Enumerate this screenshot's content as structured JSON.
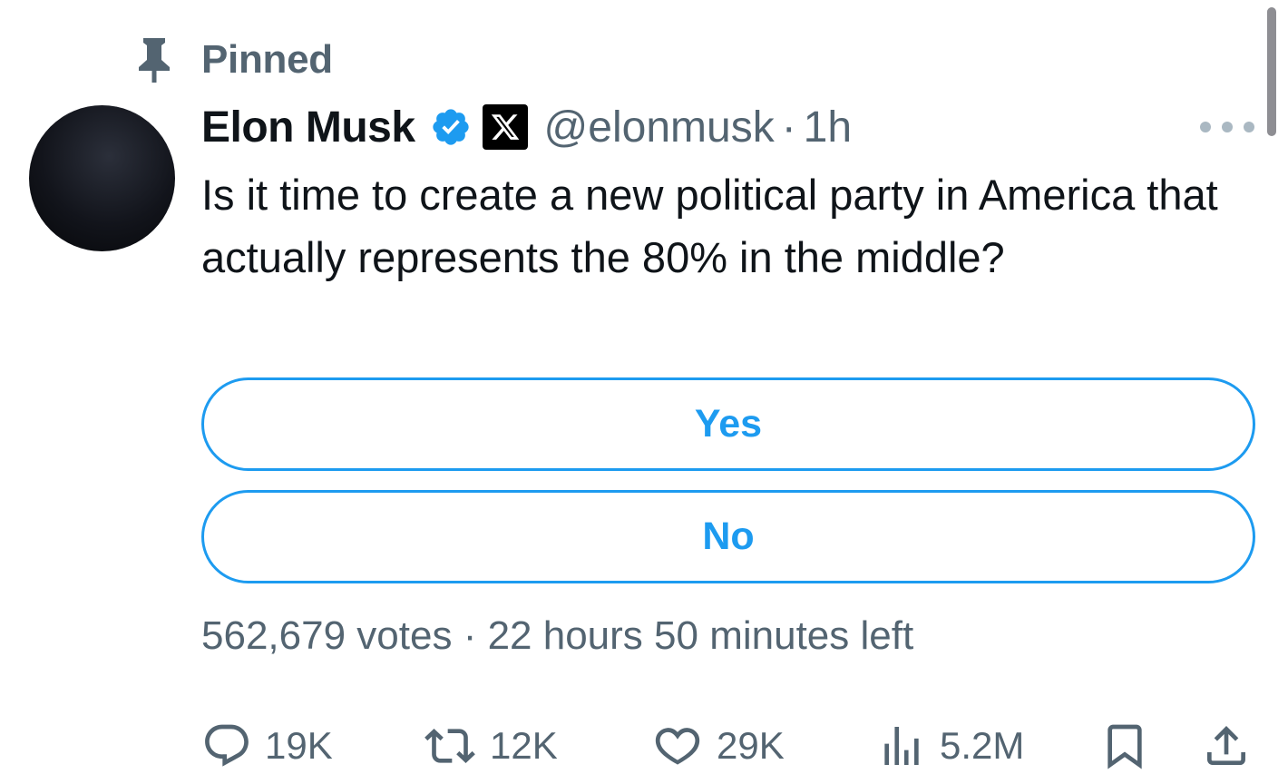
{
  "pinned": {
    "label": "Pinned"
  },
  "tweet": {
    "author": {
      "display_name": "Elon Musk",
      "handle": "@elonmusk"
    },
    "time": "1h",
    "separator": "·",
    "text": "Is it time to create a new political party in America that actually represents the 80% in the middle?"
  },
  "poll": {
    "options": [
      {
        "label": "Yes"
      },
      {
        "label": "No"
      }
    ],
    "votes": "562,679 votes",
    "separator": "·",
    "time_left": "22 hours 50 minutes left"
  },
  "actions": {
    "reply": {
      "icon": "reply-icon",
      "count": "19K"
    },
    "retweet": {
      "icon": "retweet-icon",
      "count": "12K"
    },
    "like": {
      "icon": "heart-icon",
      "count": "29K"
    },
    "views": {
      "icon": "views-icon",
      "count": "5.2M"
    },
    "bookmark": {
      "icon": "bookmark-icon"
    },
    "share": {
      "icon": "share-icon"
    }
  },
  "colors": {
    "accent": "#1d9bf0",
    "text_primary": "#0f1419",
    "text_secondary": "#536471",
    "verified": "#1d9bf0"
  }
}
